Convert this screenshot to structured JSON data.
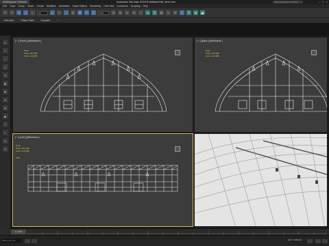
{
  "titlebar": {
    "workspace": "Workspace: Default",
    "title": "Autodesk 3ds Max 2016   ExhibitionHall_tent.max",
    "search_placeholder": "Type a keyword or phrase"
  },
  "menus": [
    "Edit",
    "Tools",
    "Group",
    "Views",
    "Create",
    "Modifiers",
    "Animation",
    "Graph Editors",
    "Rendering",
    "Civil View",
    "Customize",
    "Scripting",
    "Help"
  ],
  "toolbar": {
    "selection_filter": "All",
    "view_select": "View"
  },
  "ribbon": [
    "Selection",
    "Object Paint",
    "Populate"
  ],
  "viewports": {
    "front": {
      "label": "[ + ] [Front ] [Wireframe ]",
      "stats_title": "Total",
      "polys": "Polys:   362,080",
      "verts": "Verts:   410,398"
    },
    "back": {
      "label": "[ + ] [Back ] [Wireframe ]",
      "stats_title": "Total",
      "polys": "Polys:   362,080",
      "verts": "Verts:   410,398"
    },
    "left": {
      "label": "[ + ] [Left ] [Wireframe ]",
      "stats_title": "Total",
      "polys": "Polys:   362,080",
      "verts": "Verts:   410,398",
      "fps": "FPS:"
    },
    "camera": {
      "label": ""
    }
  },
  "timeline": {
    "slider_text": "0 / 100"
  },
  "statusbar": {
    "maxscript": "Welcome to M",
    "coord": "Grid = 100,0cm"
  },
  "colors": {
    "active_border": "#d8b54a",
    "stats_text": "#d9c24a",
    "viewport_bg": "#3c3c3c"
  }
}
